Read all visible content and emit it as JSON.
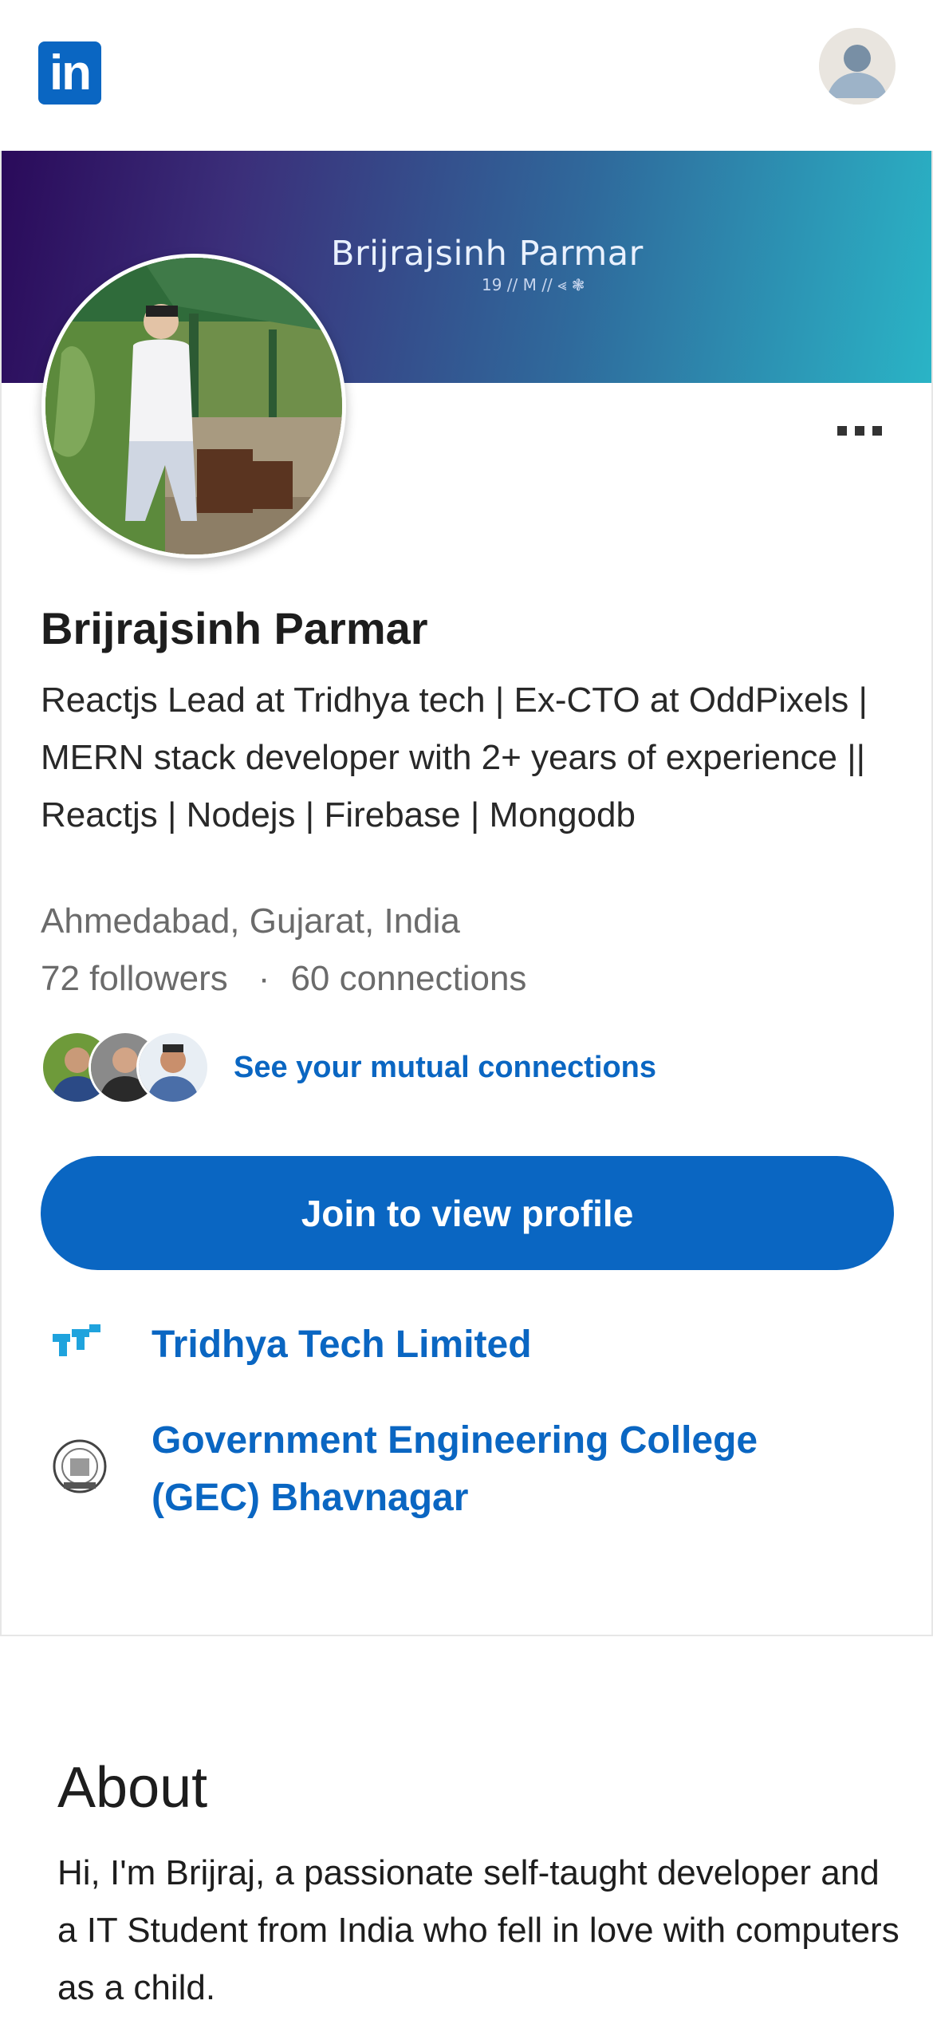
{
  "app": {
    "logo_text": "in"
  },
  "banner": {
    "title": "Brijrajsinh Parmar",
    "subtitle": "19 // M // ⪡ ❃"
  },
  "profile": {
    "name": "Brijrajsinh Parmar",
    "headline": "Reactjs Lead at Tridhya tech | Ex-CTO at OddPixels | MERN stack developer with 2+ years of experience || Reactjs | Nodejs | Firebase | Mongodb",
    "location": "Ahmedabad, Gujarat, India",
    "followers": "72 followers",
    "separator": "·",
    "connections": "60 connections",
    "mutual_link": "See your mutual connections",
    "join_button": "Join to view profile"
  },
  "experience": [
    {
      "label": "Tridhya Tech Limited",
      "icon": "tridhya-logo-icon"
    },
    {
      "label": "Government Engineering College (GEC) Bhavnagar",
      "icon": "gec-seal-icon"
    }
  ],
  "about": {
    "title": "About",
    "text": "Hi, I'm Brijraj, a passionate self-taught developer and a IT Student from India who fell in love with computers as a child."
  },
  "colors": {
    "brand": "#0a66c2",
    "tridhya": "#1fa3dd"
  }
}
